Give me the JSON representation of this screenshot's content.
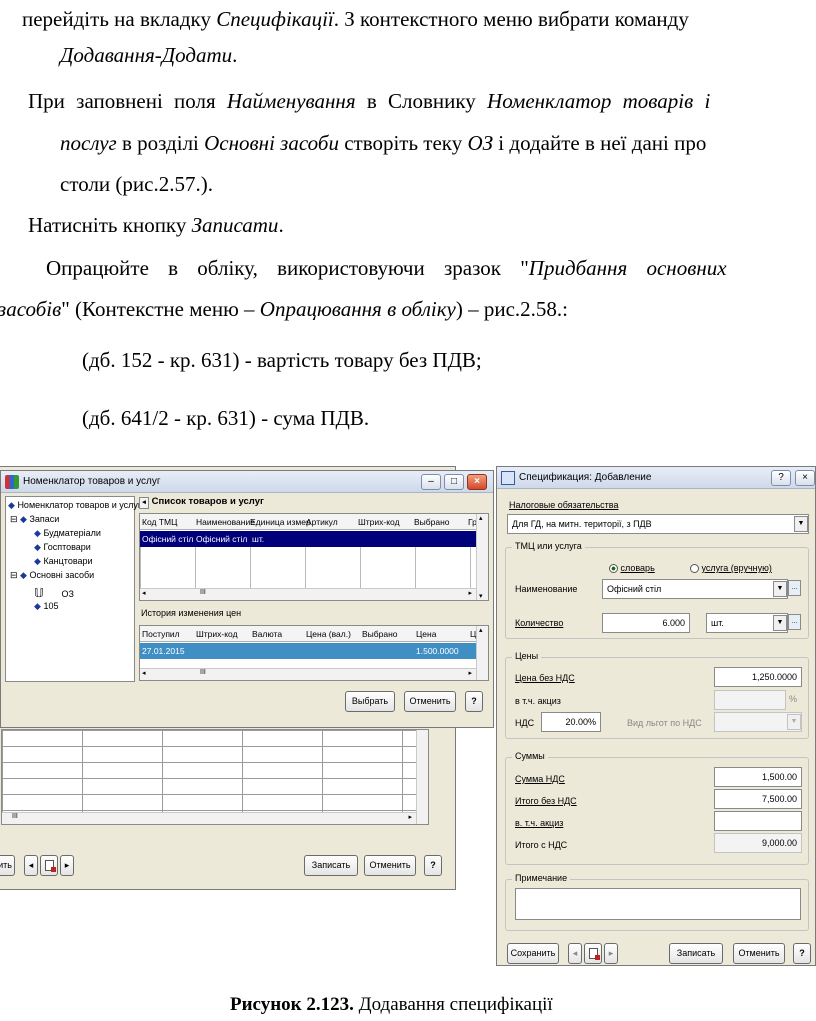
{
  "text": {
    "l1": [
      "перейдіть на вкладку ",
      "Специфікації",
      ". З контекстного меню вибрати команду"
    ],
    "l2": "Додавання-Додати",
    "l2_end": ".",
    "l3": [
      "При заповнені поля ",
      "Найменування",
      " в Словнику ",
      "Номенклатор товарів і"
    ],
    "l4": [
      "послуг",
      " в розділі ",
      "Основні засоби",
      " створіть теку ",
      "ОЗ",
      " і додайте в неї дані про"
    ],
    "l5": "столи (рис.2.57.).",
    "l6": [
      "Натисніть кнопку ",
      "Записати",
      "."
    ],
    "l7": [
      "Опрацюйте в обліку, використовуючи зразок \"",
      "Придбання основних"
    ],
    "l8": [
      "засобів",
      "\" (Контекстне меню – ",
      "Опрацювання в обліку",
      ") – рис.2.58.:"
    ],
    "l9": "(дб. 152 - кр. 631) - вартість товару без ПДВ;",
    "l10": "(дб. 641/2 - кр. 631) - сума ПДВ."
  },
  "caption": {
    "bold": "Рисунок 2.123.",
    "rest": " Додавання специфікації"
  },
  "nomenclator": {
    "title": "Номенклатор товаров и услуг",
    "tree": [
      "Номенклатор товаров и услуг",
      "Запаси",
      "Будматеріали",
      "Госптовари",
      "Канцтовари",
      "Основні засоби",
      "ОЗ",
      "105"
    ],
    "list_title": "Список товаров и услуг",
    "list_columns": [
      "Код ТМЦ",
      "Наименование",
      "Единица измер",
      "Артикул",
      "Штрих-код",
      "Выбрано",
      "Гр"
    ],
    "list_row": [
      "Офісний стіл",
      "Офісний стіл",
      "шт."
    ],
    "history_title": "История изменения цен",
    "history_columns": [
      "Поступил",
      "Штрих-код",
      "Валюта",
      "Цена (вал.)",
      "Выбрано",
      "Цена",
      "Ц"
    ],
    "history_row": [
      "27.01.2015",
      "1.500.0000"
    ],
    "btn_select": "Выбрать",
    "btn_cancel": "Отменить",
    "btn_help": "?"
  },
  "back_window": {
    "btn_partial": "ить",
    "btn_save": "Записать",
    "btn_cancel": "Отменить",
    "btn_help": "?"
  },
  "spec": {
    "title": "Спецификация: Добавление",
    "tax_label": "Налоговые обязательства",
    "tax_value": "Для ГД, на митн. території, з ПДВ",
    "group_goods": "ТМЦ или услуга",
    "radio1": "словарь",
    "radio2": "услуга (вручную)",
    "name_label": "Наименование",
    "name_value": "Офісний стіл",
    "qty_label": "Количество",
    "qty_value": "6.000",
    "unit_value": "шт.",
    "group_prices": "Цены",
    "price_label": "Цена без НДС",
    "price_value": "1,250.0000",
    "excise_label": "в т.ч. акциз",
    "vat_label": "НДС",
    "vat_value": "20.00%",
    "privilege_label": "Вид льгот по НДС",
    "group_sums": "Суммы",
    "sum_vat_label": "Сумма НДС",
    "sum_vat_value": "1,500.00",
    "total_novat_label": "Итого без НДС",
    "total_novat_value": "7,500.00",
    "excise2_label": "в. т.ч. акциз",
    "total_vat_label": "Итого с НДС",
    "total_vat_value": "9,000.00",
    "note_label": "Примечание",
    "btn_keep": "Сохранить",
    "btn_save": "Записать",
    "btn_cancel": "Отменить",
    "btn_help": "?",
    "percent_mark": "%"
  }
}
